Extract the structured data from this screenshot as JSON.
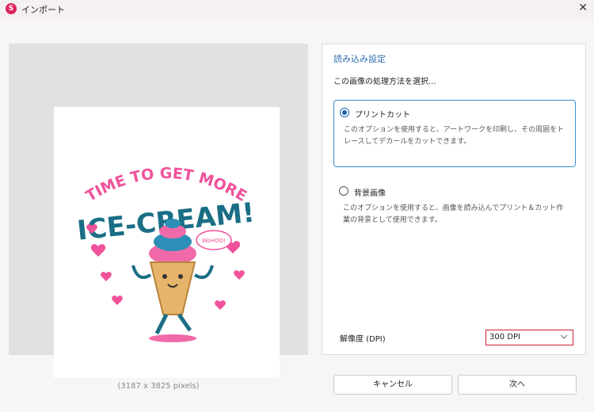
{
  "window": {
    "title": "インポート",
    "app_icon_letter": "S"
  },
  "preview": {
    "size_text": "(3187 x 3825 pixels)",
    "artwork": {
      "line1": "TIME TO GET MORE",
      "line2": "ICE-CREAM!",
      "bubble": "WoHOO!"
    }
  },
  "settings": {
    "title": "読み込み設定",
    "subtitle": "この画像の処理方法を選択...",
    "options": [
      {
        "label": "プリントカット",
        "description": "このオプションを使用すると、アートワークを印刷し、その周囲をトレースしてデカールをカットできます。",
        "selected": true
      },
      {
        "label": "背景画像",
        "description": "このオプションを使用すると、画像を読み込んでプリント＆カット作業の背景として使用できます。",
        "selected": false
      }
    ],
    "dpi_label": "解像度 (DPI)",
    "dpi_value": "300 DPI"
  },
  "buttons": {
    "cancel": "キャンセル",
    "next": "次へ"
  },
  "colors": {
    "accent": "#3a8fd1",
    "selected_radio": "#1c5fb0",
    "dpi_border": "#cc1f35",
    "title_blue": "#2b6cb0"
  }
}
